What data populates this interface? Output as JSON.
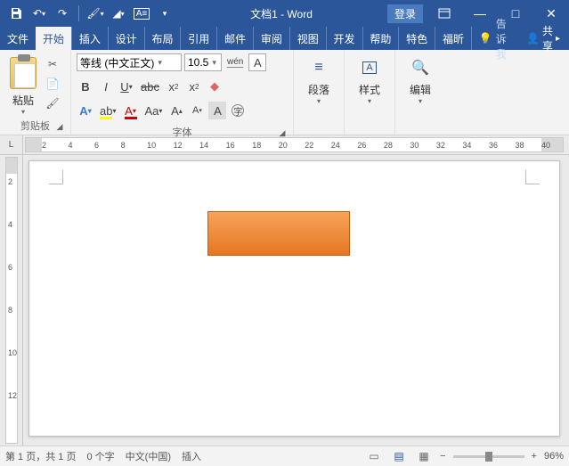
{
  "title": "文档1 - Word",
  "login": "登录",
  "tabs": [
    "文件",
    "开始",
    "插入",
    "设计",
    "布局",
    "引用",
    "邮件",
    "审阅",
    "视图",
    "开发",
    "帮助",
    "特色",
    "福昕"
  ],
  "active_tab": 1,
  "tell_me": "告诉我",
  "share": "共享",
  "clipboard_label": "剪贴板",
  "paste_label": "粘贴",
  "font_name": "等线 (中文正文)",
  "font_size": "10.5",
  "font_group_label": "字体",
  "paragraph_label": "段落",
  "styles_label": "样式",
  "editing_label": "编辑",
  "ruler_ticks": [
    2,
    4,
    6,
    8,
    10,
    12,
    14,
    16,
    18,
    20,
    22,
    24,
    26,
    28,
    30,
    32,
    34,
    36,
    38,
    40
  ],
  "ruler_start": 2,
  "vruler_ticks": [
    2,
    4,
    6,
    8,
    10,
    12
  ],
  "status": {
    "page": "第 1 页，共 1 页",
    "words": "0 个字",
    "lang": "中文(中国)",
    "mode": "插入"
  },
  "zoom": "96%",
  "chart_data": null
}
